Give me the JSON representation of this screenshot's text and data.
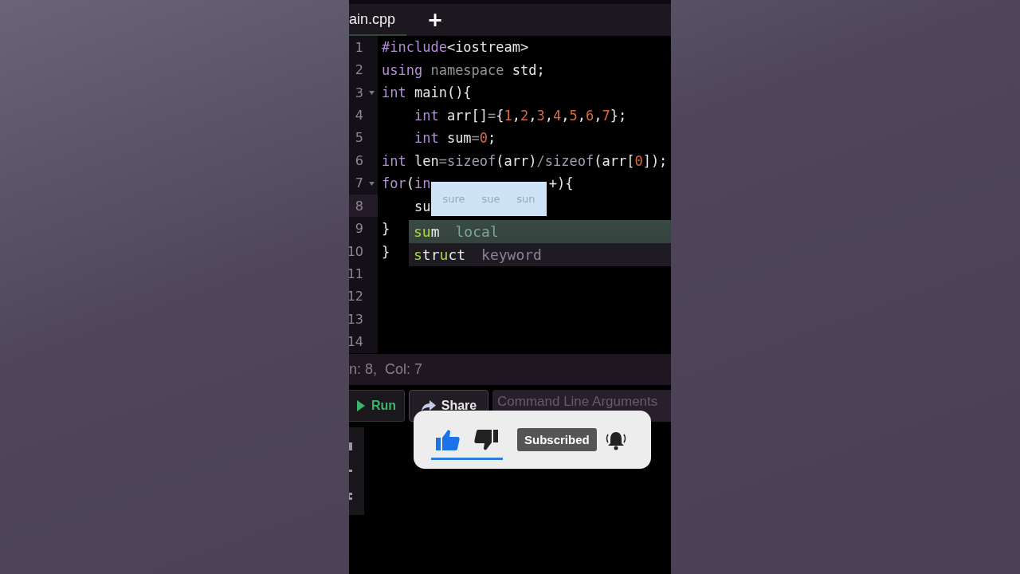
{
  "tabs": [
    {
      "label": "ain.cpp",
      "selected": true
    }
  ],
  "new_tab_button": "+",
  "code_lines": [
    {
      "number": "1",
      "fold": false,
      "current": false,
      "tokens": [
        {
          "text": "#include",
          "kind": "kw"
        },
        {
          "text": "<iostream>",
          "kind": "plain"
        }
      ]
    },
    {
      "number": "2",
      "fold": false,
      "current": false,
      "tokens": [
        {
          "text": "using",
          "kind": "kw"
        },
        {
          "text": " namespace",
          "kind": "ns"
        },
        {
          "text": " std;",
          "kind": "plain"
        }
      ]
    },
    {
      "number": "3",
      "fold": true,
      "current": false,
      "tokens": [
        {
          "text": "int",
          "kind": "kw"
        },
        {
          "text": " main(){",
          "kind": "plain"
        }
      ]
    },
    {
      "number": "4",
      "fold": false,
      "current": false,
      "tokens": [
        {
          "text": "    int",
          "kind": "kw"
        },
        {
          "text": " arr[]",
          "kind": "plain"
        },
        {
          "text": "=",
          "kind": "op"
        },
        {
          "text": "{",
          "kind": "plain"
        },
        {
          "text": "1",
          "kind": "num"
        },
        {
          "text": ",",
          "kind": "plain"
        },
        {
          "text": "2",
          "kind": "num"
        },
        {
          "text": ",",
          "kind": "plain"
        },
        {
          "text": "3",
          "kind": "num"
        },
        {
          "text": ",",
          "kind": "plain"
        },
        {
          "text": "4",
          "kind": "num"
        },
        {
          "text": ",",
          "kind": "plain"
        },
        {
          "text": "5",
          "kind": "num"
        },
        {
          "text": ",",
          "kind": "plain"
        },
        {
          "text": "6",
          "kind": "num"
        },
        {
          "text": ",",
          "kind": "plain"
        },
        {
          "text": "7",
          "kind": "num"
        },
        {
          "text": "};",
          "kind": "plain"
        }
      ]
    },
    {
      "number": "5",
      "fold": false,
      "current": false,
      "tokens": [
        {
          "text": "    int",
          "kind": "kw"
        },
        {
          "text": " sum",
          "kind": "plain"
        },
        {
          "text": "=",
          "kind": "op"
        },
        {
          "text": "0",
          "kind": "num"
        },
        {
          "text": ";",
          "kind": "plain"
        }
      ]
    },
    {
      "number": "6",
      "fold": false,
      "current": false,
      "tokens": [
        {
          "text": "int",
          "kind": "kw"
        },
        {
          "text": " len",
          "kind": "plain"
        },
        {
          "text": "=",
          "kind": "op"
        },
        {
          "text": "sizeof",
          "kind": "builtin"
        },
        {
          "text": "(arr)",
          "kind": "plain"
        },
        {
          "text": "/",
          "kind": "op"
        },
        {
          "text": "sizeof",
          "kind": "builtin"
        },
        {
          "text": "(arr[",
          "kind": "plain"
        },
        {
          "text": "0",
          "kind": "num"
        },
        {
          "text": "]);",
          "kind": "plain"
        }
      ]
    },
    {
      "number": "7",
      "fold": true,
      "current": false,
      "tokens": [
        {
          "text": "for",
          "kind": "kw"
        },
        {
          "text": "(",
          "kind": "plain"
        },
        {
          "text": "in",
          "kind": "kw"
        },
        {
          "text": "+){",
          "kind": "plain",
          "gap": true
        }
      ]
    },
    {
      "number": "8",
      "fold": false,
      "current": true,
      "tokens": [
        {
          "text": "    su",
          "kind": "plain"
        }
      ]
    },
    {
      "number": "9",
      "fold": false,
      "current": false,
      "tokens": [
        {
          "text": "}",
          "kind": "plain"
        }
      ]
    },
    {
      "number": "10",
      "fold": false,
      "current": false,
      "tokens": [
        {
          "text": "}",
          "kind": "plain"
        }
      ]
    },
    {
      "number": "11",
      "fold": false,
      "current": false
    },
    {
      "number": "12",
      "fold": false,
      "current": false
    },
    {
      "number": "13",
      "fold": false,
      "current": false
    },
    {
      "number": "14",
      "fold": false,
      "current": false
    }
  ],
  "hover_hint": {
    "words": [
      "sure",
      "sue",
      "sun"
    ]
  },
  "autocomplete": [
    {
      "parts": [
        {
          "text": "su",
          "match": true
        },
        {
          "text": "m",
          "match": false
        }
      ],
      "detail": "local",
      "selected": true
    },
    {
      "parts": [
        {
          "text": "s",
          "match": true
        },
        {
          "text": "tr",
          "match": false
        },
        {
          "text": "u",
          "match": true
        },
        {
          "text": "ct",
          "match": false
        }
      ],
      "detail": "keyword",
      "selected": false
    }
  ],
  "status_bar": "n: 8,  Col: 7",
  "run_button": "Run",
  "share_button": "Share",
  "arguments_field": {
    "placeholder": "Command Line Arguments"
  },
  "subscribe_card": {
    "like": {
      "selected": true
    },
    "dislike": {
      "selected": false
    },
    "subscribe_label": "Subscribed"
  }
}
